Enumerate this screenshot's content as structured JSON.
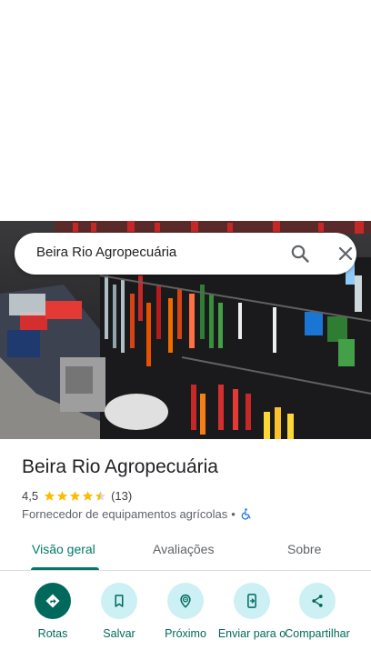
{
  "search": {
    "query": "Beira Rio Agropecuária"
  },
  "place": {
    "title": "Beira Rio Agropecuária",
    "rating": "4,5",
    "rating_value": 4.5,
    "review_count": "(13)",
    "category": "Fornecedor de equipamentos agrícolas",
    "separator": "•"
  },
  "tabs": [
    {
      "label": "Visão geral",
      "active": true
    },
    {
      "label": "Avaliações",
      "active": false
    },
    {
      "label": "Sobre",
      "active": false
    }
  ],
  "actions": [
    {
      "label": "Rotas",
      "icon": "directions-icon"
    },
    {
      "label": "Salvar",
      "icon": "bookmark-icon"
    },
    {
      "label": "Próximo",
      "icon": "nearby-icon"
    },
    {
      "label": "Enviar para o",
      "icon": "send-to-phone-icon"
    },
    {
      "label": "Compartilhar",
      "icon": "share-icon"
    }
  ],
  "colors": {
    "accent": "#00796b",
    "action_primary": "#00695c",
    "action_bg": "#ccf0f3",
    "star": "#fbbc04"
  }
}
